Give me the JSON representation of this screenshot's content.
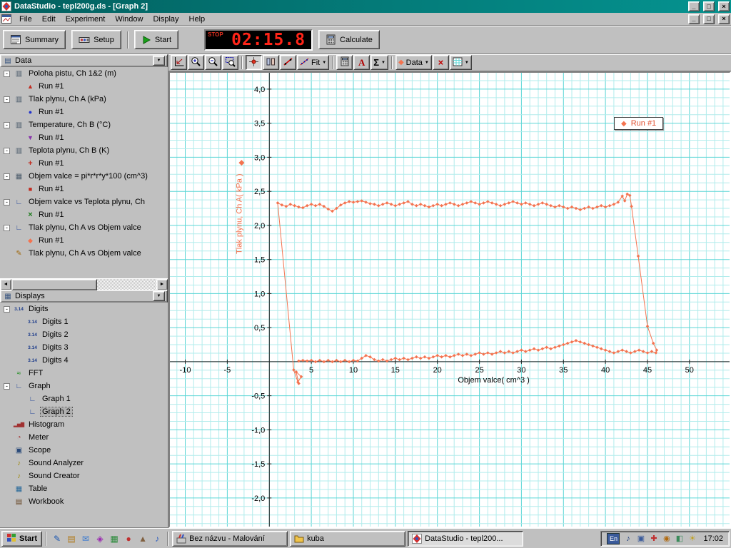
{
  "window": {
    "title": "DataStudio - tepl200g.ds - [Graph 2]",
    "menus": [
      "File",
      "Edit",
      "Experiment",
      "Window",
      "Display",
      "Help"
    ]
  },
  "toolbar": {
    "summary_label": "Summary",
    "setup_label": "Setup",
    "start_label": "Start",
    "timer_stop_label": "STOP",
    "timer_value": "02:15.8",
    "calculate_label": "Calculate"
  },
  "graph_toolbar": {
    "buttons": [
      "scale-to-fit",
      "zoom-in",
      "zoom-out",
      "zoom-select",
      "smart-tool",
      "slope-tool",
      "tangent-tool",
      "fit-menu",
      "calculate",
      "text-tool",
      "statistics-menu",
      "data-menu",
      "remove",
      "settings-menu"
    ],
    "fit_label": "Fit",
    "data_label": "Data",
    "text_tool_label": "A",
    "stats_label": "Σ"
  },
  "data_panel": {
    "title": "Data",
    "items": [
      {
        "label": "Poloha pistu, Ch 1&2 (m)",
        "icon": "sensor",
        "runs": [
          {
            "label": "Run #1",
            "marker": "triangle-up",
            "color": "#c22a1e"
          }
        ]
      },
      {
        "label": "Tlak plynu, Ch A (kPa)",
        "icon": "sensor",
        "runs": [
          {
            "label": "Run #1",
            "marker": "circle",
            "color": "#2233cc"
          }
        ]
      },
      {
        "label": "Temperature, Ch B (°C)",
        "icon": "sensor",
        "runs": [
          {
            "label": "Run #1",
            "marker": "triangle-down",
            "color": "#8833aa"
          }
        ]
      },
      {
        "label": "Teplota plynu, Ch B (K)",
        "icon": "sensor",
        "runs": [
          {
            "label": "Run #1",
            "marker": "plus",
            "color": "#c22a1e"
          }
        ]
      },
      {
        "label": "Objem valce = pi*r*r*y*100 (cm^3)",
        "icon": "calc",
        "runs": [
          {
            "label": "Run #1",
            "marker": "square",
            "color": "#c22a1e"
          }
        ]
      },
      {
        "label": "Objem valce vs Teplota plynu, Ch",
        "icon": "xy",
        "runs": [
          {
            "label": "Run #1",
            "marker": "x",
            "color": "#1a7a1a"
          }
        ]
      },
      {
        "label": "Tlak plynu, Ch A vs Objem valce",
        "icon": "xy",
        "runs": [
          {
            "label": "Run #1",
            "marker": "diamond",
            "color": "#f4734f"
          }
        ]
      },
      {
        "label": "Tlak plynu, Ch A vs Objem valce",
        "icon": "pencil",
        "runs": []
      }
    ]
  },
  "displays_panel": {
    "title": "Displays",
    "selected": "Graph 2",
    "items": [
      {
        "label": "Digits",
        "icon": "digits",
        "children": [
          {
            "label": "Digits 1",
            "icon": "digits"
          },
          {
            "label": "Digits 2",
            "icon": "digits"
          },
          {
            "label": "Digits 3",
            "icon": "digits"
          },
          {
            "label": "Digits 4",
            "icon": "digits"
          }
        ]
      },
      {
        "label": "FFT",
        "icon": "fft"
      },
      {
        "label": "Graph",
        "icon": "graph",
        "children": [
          {
            "label": "Graph 1",
            "icon": "graph"
          },
          {
            "label": "Graph 2",
            "icon": "graph"
          }
        ]
      },
      {
        "label": "Histogram",
        "icon": "histogram"
      },
      {
        "label": "Meter",
        "icon": "meter"
      },
      {
        "label": "Scope",
        "icon": "scope"
      },
      {
        "label": "Sound Analyzer",
        "icon": "sound"
      },
      {
        "label": "Sound Creator",
        "icon": "sound"
      },
      {
        "label": "Table",
        "icon": "table"
      },
      {
        "label": "Workbook",
        "icon": "workbook"
      }
    ]
  },
  "chart_data": {
    "type": "scatter",
    "title": "",
    "xlabel": "Objem valce( cm^3 )",
    "ylabel": "Tlak plynu, Ch A( kPa )",
    "legend": "Run #1",
    "legend_position": "top-right",
    "series_color": "#f4734f",
    "xlim": [
      -11.83,
      54.77
    ],
    "ylim": [
      -2.42,
      4.24
    ],
    "grid": {
      "minor_x": 1,
      "major_x": 5,
      "minor_y": 0.125,
      "major_y": 0.5,
      "minor_color": "#b2ecec",
      "major_color": "#5bd6d6"
    },
    "x_ticks": [
      {
        "v": -10,
        "label": "-10"
      },
      {
        "v": -5,
        "label": "-5"
      },
      {
        "v": 5,
        "label": "5"
      },
      {
        "v": 10,
        "label": "10"
      },
      {
        "v": 15,
        "label": "15"
      },
      {
        "v": 20,
        "label": "20"
      },
      {
        "v": 25,
        "label": "25"
      },
      {
        "v": 30,
        "label": "30"
      },
      {
        "v": 35,
        "label": "35"
      },
      {
        "v": 40,
        "label": "40"
      },
      {
        "v": 45,
        "label": "45"
      },
      {
        "v": 50,
        "label": "50"
      }
    ],
    "y_ticks": [
      {
        "v": 4,
        "label": "4,0"
      },
      {
        "v": 3.5,
        "label": "3,5"
      },
      {
        "v": 3,
        "label": "3,0"
      },
      {
        "v": 2.5,
        "label": "2,5"
      },
      {
        "v": 2,
        "label": "2,0"
      },
      {
        "v": 1.5,
        "label": "1,5"
      },
      {
        "v": 1,
        "label": "1,0"
      },
      {
        "v": 0.5,
        "label": "0,5"
      },
      {
        "v": -0.5,
        "label": "-0,5"
      },
      {
        "v": -1,
        "label": "-1,0"
      },
      {
        "v": -1.5,
        "label": "-1,5"
      },
      {
        "v": -2,
        "label": "-2,0"
      }
    ],
    "series": [
      {
        "name": "Run #1",
        "points_xy_flat": [
          3.5,
          -0.32,
          3.2,
          -0.15,
          3.8,
          -0.22,
          3.4,
          -0.3,
          2.9,
          -0.12,
          1,
          2.33,
          1.5,
          2.3,
          2,
          2.28,
          2.5,
          2.31,
          3,
          2.29,
          3.5,
          2.27,
          4,
          2.26,
          4.5,
          2.29,
          5,
          2.31,
          5.5,
          2.29,
          6,
          2.31,
          6.5,
          2.28,
          7,
          2.24,
          7.5,
          2.21,
          8,
          2.25,
          8.5,
          2.3,
          9,
          2.33,
          9.5,
          2.35,
          10,
          2.34,
          10.5,
          2.35,
          11,
          2.36,
          11.5,
          2.34,
          12,
          2.32,
          12.5,
          2.31,
          13,
          2.29,
          13.5,
          2.31,
          14,
          2.33,
          14.5,
          2.31,
          15,
          2.29,
          15.5,
          2.31,
          16,
          2.33,
          16.5,
          2.35,
          17,
          2.31,
          17.5,
          2.29,
          18,
          2.31,
          18.5,
          2.29,
          19,
          2.27,
          19.5,
          2.29,
          20,
          2.31,
          20.5,
          2.29,
          21,
          2.31,
          21.5,
          2.33,
          22,
          2.31,
          22.5,
          2.29,
          23,
          2.31,
          23.5,
          2.33,
          24,
          2.35,
          24.5,
          2.33,
          25,
          2.31,
          25.5,
          2.33,
          26,
          2.35,
          26.5,
          2.33,
          27,
          2.31,
          27.5,
          2.29,
          28,
          2.31,
          28.5,
          2.33,
          29,
          2.35,
          29.5,
          2.33,
          30,
          2.31,
          30.5,
          2.33,
          31,
          2.31,
          31.5,
          2.29,
          32,
          2.31,
          32.5,
          2.33,
          33,
          2.31,
          33.5,
          2.29,
          34,
          2.27,
          34.5,
          2.29,
          35,
          2.27,
          35.5,
          2.25,
          36,
          2.27,
          36.5,
          2.25,
          37,
          2.23,
          37.5,
          2.25,
          38,
          2.27,
          38.5,
          2.25,
          39,
          2.27,
          39.5,
          2.29,
          40,
          2.27,
          40.5,
          2.29,
          41,
          2.31,
          41.5,
          2.34,
          42,
          2.43,
          42.3,
          2.36,
          42.6,
          2.46,
          42.9,
          2.44,
          43.1,
          2.28,
          43.9,
          1.55,
          45,
          0.52,
          45.7,
          0.27,
          46.1,
          0.17,
          46,
          0.13,
          45.5,
          0.15,
          45,
          0.13,
          44.5,
          0.15,
          44,
          0.17,
          43.5,
          0.15,
          43,
          0.13,
          42.5,
          0.15,
          42,
          0.17,
          41.5,
          0.15,
          41,
          0.13,
          40.5,
          0.15,
          40,
          0.17,
          39.5,
          0.19,
          39,
          0.21,
          38.5,
          0.23,
          38,
          0.25,
          37.5,
          0.27,
          37,
          0.29,
          36.5,
          0.31,
          36,
          0.29,
          35.5,
          0.27,
          35,
          0.25,
          34.5,
          0.23,
          34,
          0.21,
          33.5,
          0.19,
          33,
          0.21,
          32.5,
          0.19,
          32,
          0.17,
          31.5,
          0.19,
          31,
          0.17,
          30.5,
          0.15,
          30,
          0.17,
          29.5,
          0.15,
          29,
          0.13,
          28.5,
          0.15,
          28,
          0.13,
          27.5,
          0.15,
          27,
          0.13,
          26.5,
          0.11,
          26,
          0.13,
          25.5,
          0.11,
          25,
          0.13,
          24.5,
          0.11,
          24,
          0.09,
          23.5,
          0.11,
          23,
          0.09,
          22.5,
          0.11,
          22,
          0.09,
          21.5,
          0.07,
          21,
          0.09,
          20.5,
          0.07,
          20,
          0.09,
          19.5,
          0.07,
          19,
          0.05,
          18.5,
          0.07,
          18,
          0.05,
          17.5,
          0.07,
          17,
          0.05,
          16.5,
          0.03,
          16,
          0.05,
          15.5,
          0.03,
          15,
          0.05,
          14.5,
          0.03,
          14,
          0.01,
          13.5,
          0.03,
          13,
          0.01,
          12.5,
          0.03,
          12,
          0.07,
          11.5,
          0.09,
          11,
          0.05,
          10.5,
          0.01,
          10,
          0.02,
          9.5,
          0,
          9,
          0.02,
          8.5,
          0,
          8,
          0.02,
          7.5,
          0,
          7,
          0.02,
          6.5,
          0,
          6,
          0.02,
          5.5,
          0,
          5,
          0.02,
          4.5,
          0.01,
          4,
          0.02,
          3.5,
          0.01
        ]
      }
    ]
  },
  "taskbar": {
    "start_label": "Start",
    "quick_launch": [
      {
        "name": "quicklaunch-icon-1",
        "glyph": "✎",
        "color": "#1a56b0"
      },
      {
        "name": "quicklaunch-icon-2",
        "glyph": "▤",
        "color": "#b07a1a"
      },
      {
        "name": "quicklaunch-icon-3",
        "glyph": "✉",
        "color": "#3a7ad0"
      },
      {
        "name": "quicklaunch-icon-4",
        "glyph": "◈",
        "color": "#9a2ab0"
      },
      {
        "name": "quicklaunch-icon-5",
        "glyph": "▦",
        "color": "#2a8a3a"
      },
      {
        "name": "quicklaunch-icon-6",
        "glyph": "●",
        "color": "#c03030"
      },
      {
        "name": "quicklaunch-icon-7",
        "glyph": "▲",
        "color": "#806040"
      },
      {
        "name": "quicklaunch-icon-8",
        "glyph": "♪",
        "color": "#3060c0"
      }
    ],
    "tasks": [
      {
        "label": "Bez názvu - Malování",
        "icon": "paint-icon",
        "active": false
      },
      {
        "label": "kuba",
        "icon": "folder-icon",
        "active": false
      },
      {
        "label": "DataStudio - tepl200...",
        "icon": "datastudio-icon",
        "active": true
      }
    ],
    "tray": {
      "language": "En",
      "time": "17:02",
      "icons": [
        {
          "name": "volume-icon",
          "glyph": "♪",
          "color": "#204080"
        },
        {
          "name": "display-icon",
          "glyph": "▣",
          "color": "#3a5a9a"
        },
        {
          "name": "antivirus-icon",
          "glyph": "✚",
          "color": "#c03030"
        },
        {
          "name": "scheduler-icon",
          "glyph": "◉",
          "color": "#b06a10"
        },
        {
          "name": "network-icon",
          "glyph": "◧",
          "color": "#3a8a5a"
        },
        {
          "name": "updater-icon",
          "glyph": "☀",
          "color": "#c0a020"
        }
      ]
    }
  }
}
